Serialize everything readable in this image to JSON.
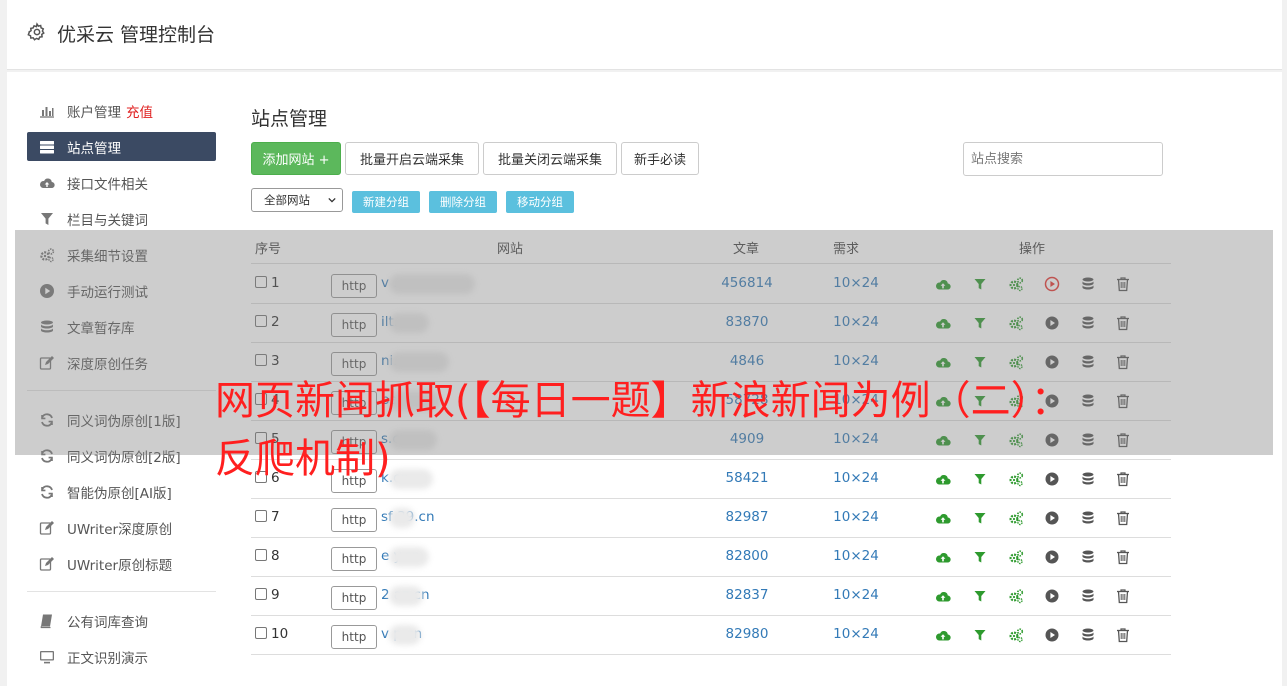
{
  "app": {
    "title": "优采云 管理控制台"
  },
  "sidebar": {
    "items": [
      {
        "label": "账户管理",
        "extra": "充值",
        "icon": "bar-chart-icon"
      },
      {
        "label": "站点管理",
        "icon": "server-icon",
        "active": true
      },
      {
        "label": "接口文件相关",
        "icon": "cloud-upload-icon"
      },
      {
        "label": "栏目与关键词",
        "icon": "filter-icon"
      },
      {
        "label": "采集细节设置",
        "icon": "gears-icon"
      },
      {
        "label": "手动运行测试",
        "icon": "play-circle-icon"
      },
      {
        "label": "文章暂存库",
        "icon": "database-icon"
      },
      {
        "label": "深度原创任务",
        "icon": "edit-icon"
      },
      {
        "label": "同义词伪原创[1版]",
        "icon": "refresh-icon"
      },
      {
        "label": "同义词伪原创[2版]",
        "icon": "refresh-icon"
      },
      {
        "label": "智能伪原创[AI版]",
        "icon": "refresh-icon"
      },
      {
        "label": "UWriter深度原创",
        "icon": "edit-icon"
      },
      {
        "label": "UWriter原创标题",
        "icon": "edit-icon"
      },
      {
        "label": "公有词库查询",
        "icon": "book-icon"
      },
      {
        "label": "正文识别演示",
        "icon": "monitor-icon"
      }
    ]
  },
  "main": {
    "title": "站点管理",
    "toolbar": {
      "add_site": "添加网站 +",
      "batch_open": "批量开启云端采集",
      "batch_close": "批量关闭云端采集",
      "newbie": "新手必读"
    },
    "search": {
      "placeholder": "站点搜索"
    },
    "group_select": {
      "value": "全部网站"
    },
    "group_buttons": {
      "new_group": "新建分组",
      "delete_group": "删除分组",
      "move_group": "移动分组"
    },
    "table": {
      "headers": {
        "index": "序号",
        "site": "网站",
        "articles": "文章",
        "demand": "需求",
        "actions": "操作"
      },
      "rows": [
        {
          "index": "1",
          "prefix": "http",
          "site": "v            .com",
          "articles": "456814",
          "demand": "10×24",
          "running": true
        },
        {
          "index": "2",
          "prefix": "http",
          "site": "       ilt.cn",
          "articles": "83870",
          "demand": "10×24",
          "running": false
        },
        {
          "index": "3",
          "prefix": "http",
          "site": "        ni.cn",
          "articles": "4846",
          "demand": "10×24",
          "running": false
        },
        {
          "index": "4",
          "prefix": "http",
          "site": "      pan.cn",
          "articles": "58728",
          "demand": "10×24",
          "running": false
        },
        {
          "index": "5",
          "prefix": "http",
          "site": "       s.cn",
          "articles": "4909",
          "demand": "10×24",
          "running": false
        },
        {
          "index": "6",
          "prefix": "http",
          "site": "       k.cn",
          "articles": "58421",
          "demand": "10×24",
          "running": false
        },
        {
          "index": "7",
          "prefix": "http",
          "site": "sf    39.cn",
          "articles": "82987",
          "demand": "10×24",
          "running": false
        },
        {
          "index": "8",
          "prefix": "http",
          "site": "e      y.cn",
          "articles": "82800",
          "demand": "10×24",
          "running": false
        },
        {
          "index": "9",
          "prefix": "http",
          "site": "2      az.cn",
          "articles": "82837",
          "demand": "10×24",
          "running": false
        },
        {
          "index": "10",
          "prefix": "http",
          "site": "v      p.cn",
          "articles": "82980",
          "demand": "10×24",
          "running": false
        }
      ]
    }
  },
  "overlay": {
    "headline": "网页新闻抓取(【每日一题】新浪新闻为例（二）：反爬机制)"
  },
  "colors": {
    "accent_green": "#5cb85c",
    "sidebar_active": "#3b4a63",
    "link_blue": "#337ab7",
    "info_blue": "#5bc0de",
    "headline_red": "#ff1f1f",
    "run_red": "#e8342f",
    "icon_green": "#2e9a2e"
  }
}
